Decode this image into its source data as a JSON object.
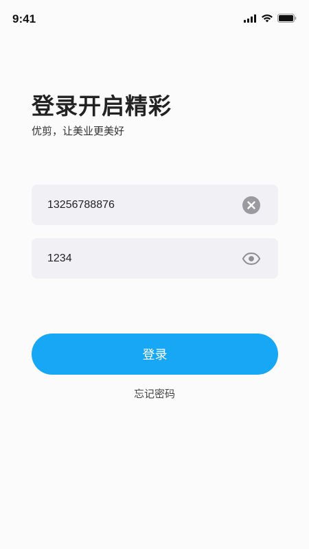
{
  "status_bar": {
    "time": "9:41"
  },
  "header": {
    "title": "登录开启精彩",
    "subtitle": "优剪，让美业更美好"
  },
  "form": {
    "phone_value": "13256788876",
    "phone_clear_icon": "clear-circle-icon",
    "code_value": "1234",
    "code_visibility_icon": "eye-icon"
  },
  "actions": {
    "login_label": "登录",
    "forgot_label": "忘记密码"
  },
  "colors": {
    "accent": "#17a7f5",
    "field_background": "#f1f1f5",
    "page_background": "#fbfbfb"
  }
}
